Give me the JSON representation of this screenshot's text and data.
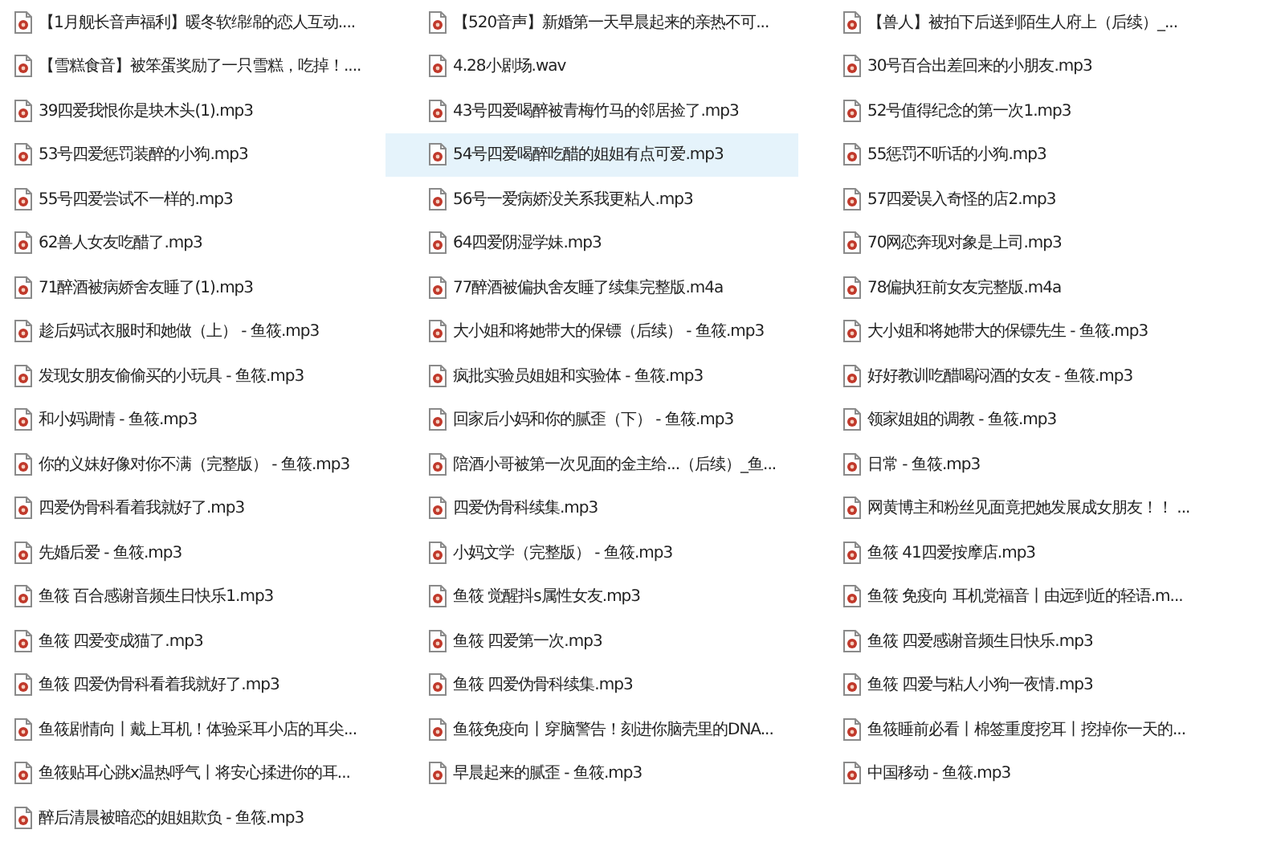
{
  "columns": [
    {
      "files": [
        {
          "name": "【1月舰长音声福利】暖冬软绵绵的恋人互动....",
          "selected": false
        },
        {
          "name": "【雪糕食音】被笨蛋奖励了一只雪糕，吃掉！....",
          "selected": false
        },
        {
          "name": "39四爱我恨你是块木头(1).mp3",
          "selected": false
        },
        {
          "name": "53号四爱惩罚装醉的小狗.mp3",
          "selected": false
        },
        {
          "name": "55号四爱尝试不一样的.mp3",
          "selected": false
        },
        {
          "name": "62兽人女友吃醋了.mp3",
          "selected": false
        },
        {
          "name": "71醉酒被病娇舍友睡了(1).mp3",
          "selected": false
        },
        {
          "name": "趁后妈试衣服时和她做（上） - 鱼筱.mp3",
          "selected": false
        },
        {
          "name": "发现女朋友偷偷买的小玩具 - 鱼筱.mp3",
          "selected": false
        },
        {
          "name": "和小妈调情 - 鱼筱.mp3",
          "selected": false
        },
        {
          "name": "你的义妹好像对你不满（完整版） - 鱼筱.mp3",
          "selected": false
        },
        {
          "name": "四爱伪骨科看着我就好了.mp3",
          "selected": false
        },
        {
          "name": "先婚后爱 - 鱼筱.mp3",
          "selected": false
        },
        {
          "name": "鱼筱 百合感谢音频生日快乐1.mp3",
          "selected": false
        },
        {
          "name": "鱼筱 四爱变成猫了.mp3",
          "selected": false
        },
        {
          "name": "鱼筱 四爱伪骨科看着我就好了.mp3",
          "selected": false
        },
        {
          "name": "鱼筱剧情向丨戴上耳机！体验采耳小店的耳尖...",
          "selected": false
        },
        {
          "name": "鱼筱贴耳心跳x温热呼气丨将安心揉进你的耳...",
          "selected": false
        },
        {
          "name": "醉后清晨被暗恋的姐姐欺负 - 鱼筱.mp3",
          "selected": false
        }
      ]
    },
    {
      "files": [
        {
          "name": "【520音声】新婚第一天早晨起来的亲热不可...",
          "selected": false
        },
        {
          "name": "4.28小剧场.wav",
          "selected": false
        },
        {
          "name": "43号四爱喝醉被青梅竹马的邻居捡了.mp3",
          "selected": false
        },
        {
          "name": "54号四爱喝醉吃醋的姐姐有点可爱.mp3",
          "selected": true
        },
        {
          "name": "56号一爱病娇没关系我更粘人.mp3",
          "selected": false
        },
        {
          "name": "64四爱阴湿学妹.mp3",
          "selected": false
        },
        {
          "name": "77醉酒被偏执舍友睡了续集完整版.m4a",
          "selected": false
        },
        {
          "name": "大小姐和将她带大的保镖（后续） - 鱼筱.mp3",
          "selected": false
        },
        {
          "name": "疯批实验员姐姐和实验体 - 鱼筱.mp3",
          "selected": false
        },
        {
          "name": "回家后小妈和你的腻歪（下） - 鱼筱.mp3",
          "selected": false
        },
        {
          "name": "陪酒小哥被第一次见面的金主给...（后续）_鱼...",
          "selected": false
        },
        {
          "name": "四爱伪骨科续集.mp3",
          "selected": false
        },
        {
          "name": "小妈文学（完整版） - 鱼筱.mp3",
          "selected": false
        },
        {
          "name": "鱼筱 觉醒抖s属性女友.mp3",
          "selected": false
        },
        {
          "name": "鱼筱 四爱第一次.mp3",
          "selected": false
        },
        {
          "name": "鱼筱 四爱伪骨科续集.mp3",
          "selected": false
        },
        {
          "name": "鱼筱免疫向丨穿脑警告！刻进你脑壳里的DNA...",
          "selected": false
        },
        {
          "name": "早晨起来的腻歪 - 鱼筱.mp3",
          "selected": false
        }
      ]
    },
    {
      "files": [
        {
          "name": "【兽人】被拍下后送到陌生人府上（后续）_...",
          "selected": false
        },
        {
          "name": "30号百合出差回来的小朋友.mp3",
          "selected": false
        },
        {
          "name": "52号值得纪念的第一次1.mp3",
          "selected": false
        },
        {
          "name": "55惩罚不听话的小狗.mp3",
          "selected": false
        },
        {
          "name": "57四爱误入奇怪的店2.mp3",
          "selected": false
        },
        {
          "name": "70网恋奔现对象是上司.mp3",
          "selected": false
        },
        {
          "name": "78偏执狂前女友完整版.m4a",
          "selected": false
        },
        {
          "name": "大小姐和将她带大的保镖先生 - 鱼筱.mp3",
          "selected": false
        },
        {
          "name": "好好教训吃醋喝闷酒的女友 - 鱼筱.mp3",
          "selected": false
        },
        {
          "name": "领家姐姐的调教 - 鱼筱.mp3",
          "selected": false
        },
        {
          "name": "日常 - 鱼筱.mp3",
          "selected": false
        },
        {
          "name": "网黄博主和粉丝见面竟把她发展成女朋友！！ ...",
          "selected": false
        },
        {
          "name": "鱼筱 41四爱按摩店.mp3",
          "selected": false
        },
        {
          "name": "鱼筱 免疫向 耳机党福音丨由远到近的轻语.m...",
          "selected": false
        },
        {
          "name": "鱼筱 四爱感谢音频生日快乐.mp3",
          "selected": false
        },
        {
          "name": "鱼筱 四爱与粘人小狗一夜情.mp3",
          "selected": false
        },
        {
          "name": "鱼筱睡前必看丨棉签重度挖耳丨挖掉你一天的...",
          "selected": false
        },
        {
          "name": "中国移动 - 鱼筱.mp3",
          "selected": false
        }
      ]
    }
  ]
}
